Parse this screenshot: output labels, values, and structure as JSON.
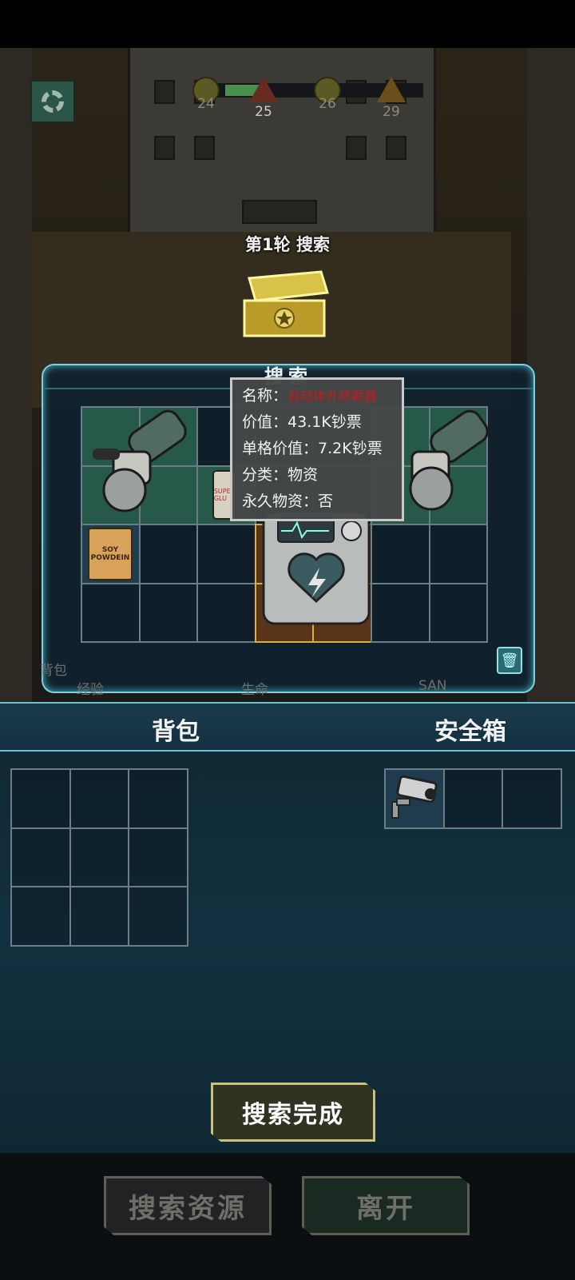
{
  "hud": {
    "waves": [
      {
        "num": "24",
        "kind": "circle"
      },
      {
        "num": "25",
        "kind": "triangle-red"
      },
      {
        "num": "26",
        "kind": "circle"
      },
      {
        "num": "29",
        "kind": "triangle-orange"
      }
    ]
  },
  "search": {
    "round_title": "第1轮 搜索",
    "panel_title": "搜索"
  },
  "tooltip": {
    "name_label": "名称：",
    "name_value": "自动体外除颤器",
    "value_label": "价值：",
    "value_value": "43.1K钞票",
    "unit_value_label": "单格价值：",
    "unit_value_value": "7.2K钞票",
    "category_label": "分类：",
    "category_value": "物资",
    "permanent_label": "永久物资：",
    "permanent_value": "否"
  },
  "items": {
    "soy_label_1": "SOY",
    "soy_label_2": "POWDEIN",
    "glue_label": "SUPER GLU"
  },
  "stats": {
    "exp": "经验",
    "life": "生命",
    "san": "SAN",
    "bag_small": "背包"
  },
  "inventory": {
    "bag_title": "背包",
    "safe_title": "安全箱"
  },
  "actions": {
    "done": "搜索完成",
    "search_resources": "搜索资源",
    "leave": "离开"
  },
  "colors": {
    "accent": "#7fd1e0",
    "item_name": "#c21c1c",
    "gold": "#d8b23a"
  }
}
